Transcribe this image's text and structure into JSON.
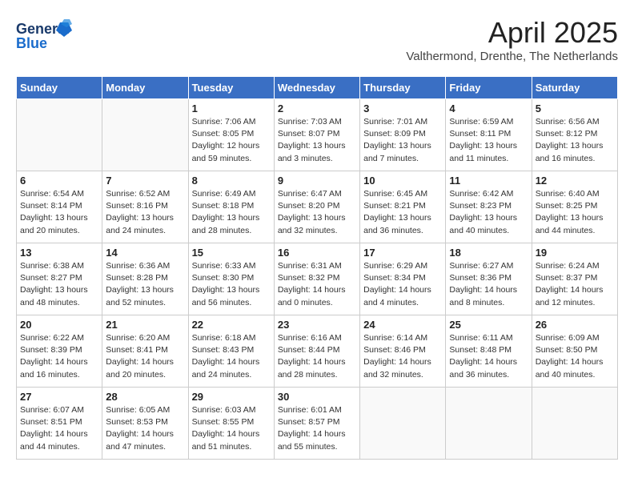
{
  "header": {
    "logo_line1": "General",
    "logo_line2": "Blue",
    "month": "April 2025",
    "location": "Valthermond, Drenthe, The Netherlands"
  },
  "weekdays": [
    "Sunday",
    "Monday",
    "Tuesday",
    "Wednesday",
    "Thursday",
    "Friday",
    "Saturday"
  ],
  "weeks": [
    [
      {
        "day": "",
        "info": ""
      },
      {
        "day": "",
        "info": ""
      },
      {
        "day": "1",
        "info": "Sunrise: 7:06 AM\nSunset: 8:05 PM\nDaylight: 12 hours and 59 minutes."
      },
      {
        "day": "2",
        "info": "Sunrise: 7:03 AM\nSunset: 8:07 PM\nDaylight: 13 hours and 3 minutes."
      },
      {
        "day": "3",
        "info": "Sunrise: 7:01 AM\nSunset: 8:09 PM\nDaylight: 13 hours and 7 minutes."
      },
      {
        "day": "4",
        "info": "Sunrise: 6:59 AM\nSunset: 8:11 PM\nDaylight: 13 hours and 11 minutes."
      },
      {
        "day": "5",
        "info": "Sunrise: 6:56 AM\nSunset: 8:12 PM\nDaylight: 13 hours and 16 minutes."
      }
    ],
    [
      {
        "day": "6",
        "info": "Sunrise: 6:54 AM\nSunset: 8:14 PM\nDaylight: 13 hours and 20 minutes."
      },
      {
        "day": "7",
        "info": "Sunrise: 6:52 AM\nSunset: 8:16 PM\nDaylight: 13 hours and 24 minutes."
      },
      {
        "day": "8",
        "info": "Sunrise: 6:49 AM\nSunset: 8:18 PM\nDaylight: 13 hours and 28 minutes."
      },
      {
        "day": "9",
        "info": "Sunrise: 6:47 AM\nSunset: 8:20 PM\nDaylight: 13 hours and 32 minutes."
      },
      {
        "day": "10",
        "info": "Sunrise: 6:45 AM\nSunset: 8:21 PM\nDaylight: 13 hours and 36 minutes."
      },
      {
        "day": "11",
        "info": "Sunrise: 6:42 AM\nSunset: 8:23 PM\nDaylight: 13 hours and 40 minutes."
      },
      {
        "day": "12",
        "info": "Sunrise: 6:40 AM\nSunset: 8:25 PM\nDaylight: 13 hours and 44 minutes."
      }
    ],
    [
      {
        "day": "13",
        "info": "Sunrise: 6:38 AM\nSunset: 8:27 PM\nDaylight: 13 hours and 48 minutes."
      },
      {
        "day": "14",
        "info": "Sunrise: 6:36 AM\nSunset: 8:28 PM\nDaylight: 13 hours and 52 minutes."
      },
      {
        "day": "15",
        "info": "Sunrise: 6:33 AM\nSunset: 8:30 PM\nDaylight: 13 hours and 56 minutes."
      },
      {
        "day": "16",
        "info": "Sunrise: 6:31 AM\nSunset: 8:32 PM\nDaylight: 14 hours and 0 minutes."
      },
      {
        "day": "17",
        "info": "Sunrise: 6:29 AM\nSunset: 8:34 PM\nDaylight: 14 hours and 4 minutes."
      },
      {
        "day": "18",
        "info": "Sunrise: 6:27 AM\nSunset: 8:36 PM\nDaylight: 14 hours and 8 minutes."
      },
      {
        "day": "19",
        "info": "Sunrise: 6:24 AM\nSunset: 8:37 PM\nDaylight: 14 hours and 12 minutes."
      }
    ],
    [
      {
        "day": "20",
        "info": "Sunrise: 6:22 AM\nSunset: 8:39 PM\nDaylight: 14 hours and 16 minutes."
      },
      {
        "day": "21",
        "info": "Sunrise: 6:20 AM\nSunset: 8:41 PM\nDaylight: 14 hours and 20 minutes."
      },
      {
        "day": "22",
        "info": "Sunrise: 6:18 AM\nSunset: 8:43 PM\nDaylight: 14 hours and 24 minutes."
      },
      {
        "day": "23",
        "info": "Sunrise: 6:16 AM\nSunset: 8:44 PM\nDaylight: 14 hours and 28 minutes."
      },
      {
        "day": "24",
        "info": "Sunrise: 6:14 AM\nSunset: 8:46 PM\nDaylight: 14 hours and 32 minutes."
      },
      {
        "day": "25",
        "info": "Sunrise: 6:11 AM\nSunset: 8:48 PM\nDaylight: 14 hours and 36 minutes."
      },
      {
        "day": "26",
        "info": "Sunrise: 6:09 AM\nSunset: 8:50 PM\nDaylight: 14 hours and 40 minutes."
      }
    ],
    [
      {
        "day": "27",
        "info": "Sunrise: 6:07 AM\nSunset: 8:51 PM\nDaylight: 14 hours and 44 minutes."
      },
      {
        "day": "28",
        "info": "Sunrise: 6:05 AM\nSunset: 8:53 PM\nDaylight: 14 hours and 47 minutes."
      },
      {
        "day": "29",
        "info": "Sunrise: 6:03 AM\nSunset: 8:55 PM\nDaylight: 14 hours and 51 minutes."
      },
      {
        "day": "30",
        "info": "Sunrise: 6:01 AM\nSunset: 8:57 PM\nDaylight: 14 hours and 55 minutes."
      },
      {
        "day": "",
        "info": ""
      },
      {
        "day": "",
        "info": ""
      },
      {
        "day": "",
        "info": ""
      }
    ]
  ]
}
